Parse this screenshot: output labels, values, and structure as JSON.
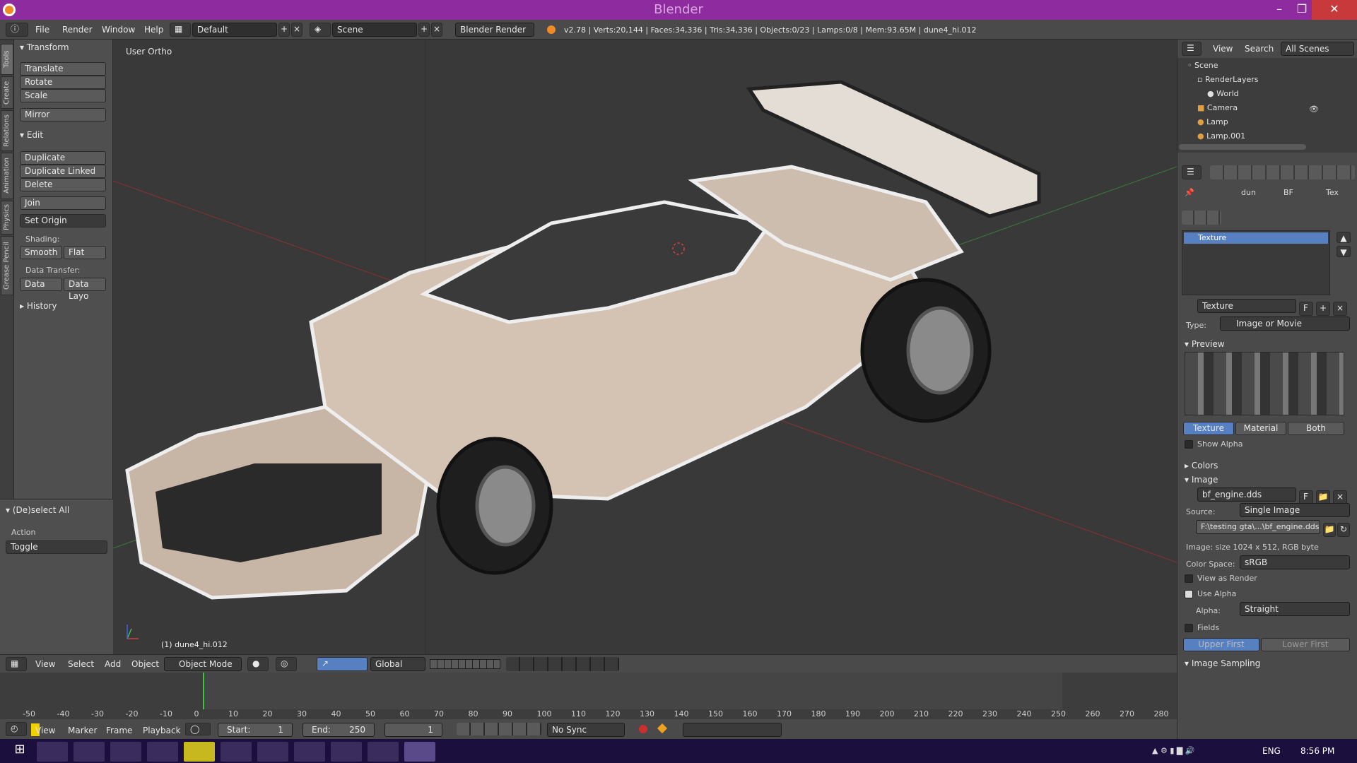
{
  "window": {
    "title": "Blender"
  },
  "infobar": {
    "menus": [
      "File",
      "Render",
      "Window",
      "Help"
    ],
    "layout": "Default",
    "scene": "Scene",
    "engine": "Blender Render",
    "stats": "v2.78 | Verts:20,144 | Faces:34,336 | Tris:34,336 | Objects:0/23 | Lamps:0/8 | Mem:93.65M | dune4_hi.012"
  },
  "lefttabs": [
    "Tools",
    "Create",
    "Relations",
    "Animation",
    "Physics",
    "Grease Pencil"
  ],
  "toolshelf": {
    "transform": {
      "header": "Transform",
      "buttons": [
        "Translate",
        "Rotate",
        "Scale",
        "Mirror"
      ]
    },
    "edit": {
      "header": "Edit",
      "buttons": [
        "Duplicate",
        "Duplicate Linked",
        "Delete",
        "Join"
      ],
      "set_origin": "Set Origin",
      "shading_label": "Shading:",
      "smooth": "Smooth",
      "flat": "Flat",
      "data_transfer_label": "Data Transfer:",
      "data": "Data",
      "data_layout": "Data Layo"
    },
    "history": "History",
    "deselect": {
      "header": "(De)select All",
      "action_label": "Action",
      "action_value": "Toggle"
    }
  },
  "viewport": {
    "view_label": "User Ortho",
    "object_label": "(1) dune4_hi.012"
  },
  "outliner": {
    "menus": [
      "View",
      "Search"
    ],
    "filter": "All Scenes",
    "items": [
      "Scene",
      "RenderLayers",
      "World",
      "Camera",
      "Lamp",
      "Lamp.001"
    ]
  },
  "properties": {
    "breadcrumb": [
      "dun",
      "BF",
      "Tex"
    ],
    "slot_active": "Texture",
    "texture_name": "Texture",
    "texture_fake": "F",
    "type_label": "Type:",
    "type_value": "Image or Movie",
    "preview_header": "Preview",
    "preview_tabs": [
      "Texture",
      "Material",
      "Both"
    ],
    "show_alpha": "Show Alpha",
    "colors_header": "Colors",
    "image_header": "Image",
    "image_name": "bf_engine.dds",
    "image_fake": "F",
    "source_label": "Source:",
    "source_value": "Single Image",
    "filepath": "F:\\testing gta\\...\\bf_engine.dds",
    "image_info": "Image: size 1024 x 512, RGB byte",
    "colorspace_label": "Color Space:",
    "colorspace_value": "sRGB",
    "view_as_render": "View as Render",
    "use_alpha": "Use Alpha",
    "alpha_label": "Alpha:",
    "alpha_value": "Straight",
    "fields": "Fields",
    "upper_first": "Upper First",
    "lower_first": "Lower First",
    "sampling_header": "Image Sampling"
  },
  "vp_header": {
    "menus": [
      "View",
      "Select",
      "Add",
      "Object"
    ],
    "mode": "Object Mode",
    "orientation": "Global"
  },
  "timeline": {
    "ticks": [
      "-50",
      "-40",
      "-30",
      "-20",
      "-10",
      "0",
      "10",
      "20",
      "30",
      "40",
      "50",
      "60",
      "70",
      "80",
      "90",
      "100",
      "110",
      "120",
      "130",
      "140",
      "150",
      "160",
      "170",
      "180",
      "190",
      "200",
      "210",
      "220",
      "230",
      "240",
      "250",
      "260",
      "270",
      "280"
    ],
    "current_frame_tick": "0"
  },
  "tl_header": {
    "menus": [
      "View",
      "Marker",
      "Frame",
      "Playback"
    ],
    "start_label": "Start:",
    "start_value": "1",
    "end_label": "End:",
    "end_value": "250",
    "current": "1",
    "sync": "No Sync"
  },
  "taskbar": {
    "lang": "ENG",
    "time": "8:56 PM"
  },
  "colors": {
    "titlebar": "#8e2b9e",
    "taskbar": "#1b0f3d",
    "accent": "#5680c2",
    "timeline_cursor": "#3ec43e"
  }
}
